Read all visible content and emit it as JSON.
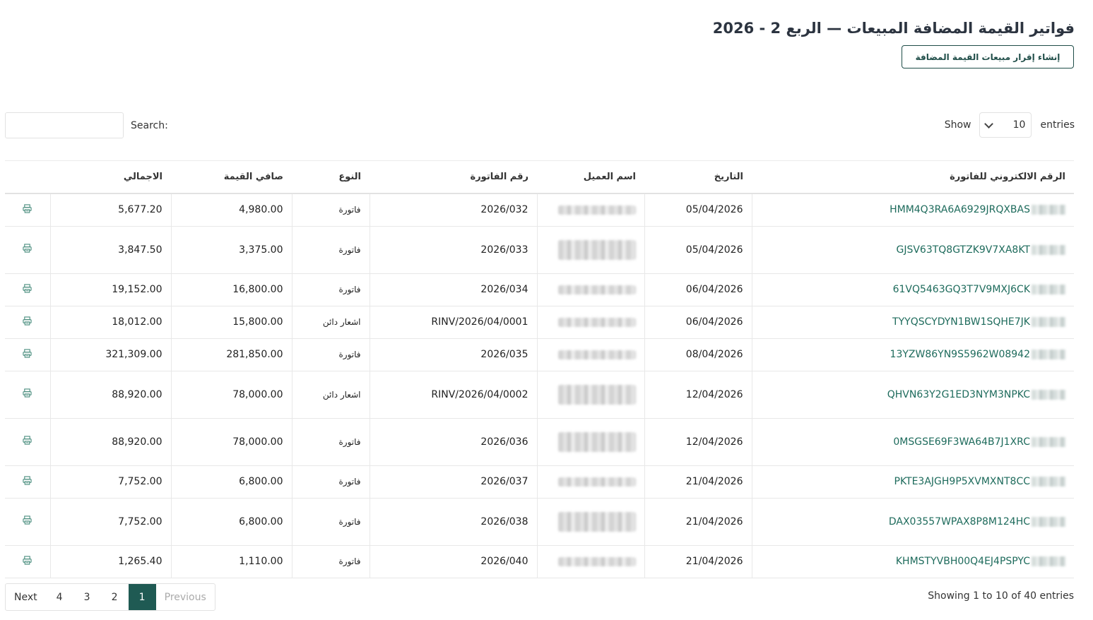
{
  "page": {
    "title": "فواتير القيمة المضافة المبيعات — الربع 2 - 2026",
    "create_button": "إنشاء إقرار مبيعات القيمة المضافة"
  },
  "length_menu": {
    "show": "Show",
    "value": "10",
    "entries": "entries"
  },
  "search": {
    "label": "Search:",
    "value": ""
  },
  "table": {
    "columns": [
      "الرقم الالكتروني للفاتورة",
      "التاريخ",
      "اسم العميل",
      "رقم الفاتورة",
      "النوع",
      "صافي القيمة",
      "الاجمالي",
      ""
    ],
    "rows": [
      {
        "uuid": "HMM4Q3RA6A6929JRQXBAS",
        "date": "05/04/2026",
        "invoice": "2026/032",
        "type": "فاتورة",
        "net": "4,980.00",
        "total": "5,677.20"
      },
      {
        "uuid": "GJSV63TQ8GTZK9V7XA8KT",
        "date": "05/04/2026",
        "invoice": "2026/033",
        "type": "فاتورة",
        "net": "3,375.00",
        "total": "3,847.50"
      },
      {
        "uuid": "61VQ5463GQ3T7V9MXJ6CK",
        "date": "06/04/2026",
        "invoice": "2026/034",
        "type": "فاتورة",
        "net": "16,800.00",
        "total": "19,152.00"
      },
      {
        "uuid": "TYYQSCYDYN1BW1SQHE7JK",
        "date": "06/04/2026",
        "invoice": "RINV/2026/04/0001",
        "type": "اشعار دائن",
        "net": "15,800.00",
        "total": "18,012.00"
      },
      {
        "uuid": "13YZW86YN9S5962W08942",
        "date": "08/04/2026",
        "invoice": "2026/035",
        "type": "فاتورة",
        "net": "281,850.00",
        "total": "321,309.00"
      },
      {
        "uuid": "QHVN63Y2G1ED3NYM3NPKC",
        "date": "12/04/2026",
        "invoice": "RINV/2026/04/0002",
        "type": "اشعار دائن",
        "net": "78,000.00",
        "total": "88,920.00"
      },
      {
        "uuid": "0MSGSE69F3WA64B7J1XRC",
        "date": "12/04/2026",
        "invoice": "2026/036",
        "type": "فاتورة",
        "net": "78,000.00",
        "total": "88,920.00"
      },
      {
        "uuid": "PKTE3AJGH9P5XVMXNT8CC",
        "date": "21/04/2026",
        "invoice": "2026/037",
        "type": "فاتورة",
        "net": "6,800.00",
        "total": "7,752.00"
      },
      {
        "uuid": "DAX03557WPAX8P8M124HC",
        "date": "21/04/2026",
        "invoice": "2026/038",
        "type": "فاتورة",
        "net": "6,800.00",
        "total": "7,752.00"
      },
      {
        "uuid": "KHMSTYVBH00Q4EJ4PSPYC",
        "date": "21/04/2026",
        "invoice": "2026/040",
        "type": "فاتورة",
        "net": "1,110.00",
        "total": "1,265.40"
      }
    ]
  },
  "info": "Showing 1 to 10 of 40 entries",
  "pagination": {
    "next": "Next",
    "pages": [
      "4",
      "3",
      "2",
      "1"
    ],
    "active": "1",
    "previous": "Previous"
  },
  "icons": {
    "print": "print-icon"
  },
  "colors": {
    "accent": "#1f5a53",
    "link": "#1e6b5c"
  }
}
